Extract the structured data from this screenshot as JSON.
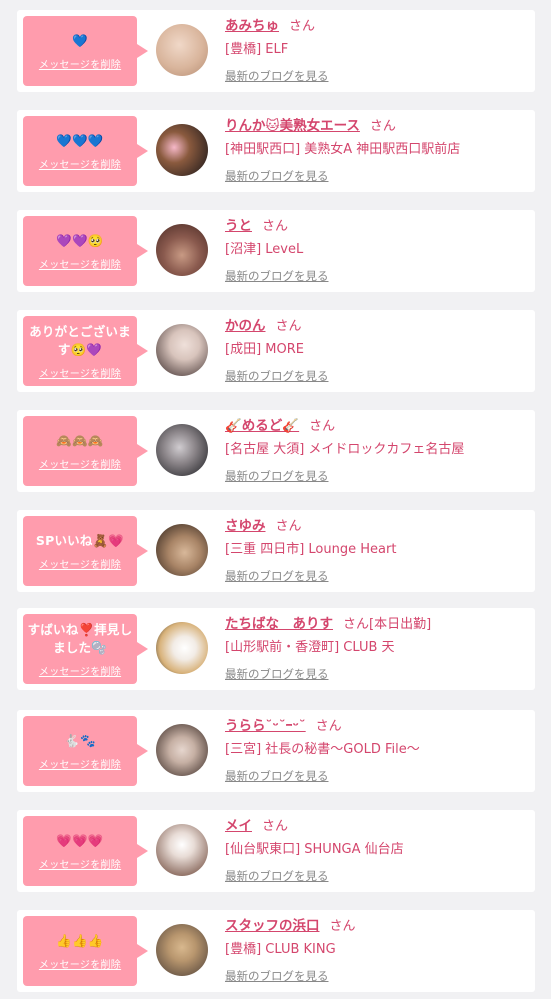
{
  "delete_label": "メッセージを削除",
  "san_label": "さん",
  "blog_label": "最新のブログを見る",
  "colors": {
    "bubble": "#ff9cad",
    "name": "#d4466d",
    "background": "#f1f1f3"
  },
  "items": [
    {
      "message": "💙",
      "name": "あみちゅ",
      "extra": "",
      "shop": "[豊橋] ELF",
      "avatar_colors": [
        "#d9b59c",
        "#f0d8c8"
      ]
    },
    {
      "message": "💙💙💙",
      "name": "りんか🐱美熟女エース",
      "extra": "",
      "shop": "[神田駅西口] 美熟女A 神田駅西口駅前店",
      "avatar_colors": [
        "#3a2a24",
        "#8a5a3e"
      ]
    },
    {
      "message": "💜💜🥺",
      "name": "うと",
      "extra": "",
      "shop": "[沼津] LeveL",
      "avatar_colors": [
        "#6a4036",
        "#c89a84"
      ]
    },
    {
      "message": "ありがとございます🥺💜",
      "name": "かのん",
      "extra": "",
      "shop": "[成田] MORE",
      "avatar_colors": [
        "#5a4a48",
        "#d8c4bc"
      ]
    },
    {
      "message": "🙈🙈🙈",
      "name": "🎸めるど🎸",
      "extra": "",
      "shop": "[名古屋 大須] メイドロックカフェ名古屋",
      "avatar_colors": [
        "#3a3a3e",
        "#d0ccd0"
      ]
    },
    {
      "message": "SPいいね🧸💗",
      "name": "さゆみ",
      "extra": "",
      "shop": "[三重 四日市] Lounge Heart",
      "avatar_colors": [
        "#4e3a2e",
        "#a88466"
      ]
    },
    {
      "message": "すばいね❣️拝見しました🫧",
      "name": "たちばな　ありす",
      "extra": "[本日出勤]",
      "shop": "[山形駅前・香澄町] CLUB 天",
      "avatar_colors": [
        "#d8b27a",
        "#f2ece6"
      ]
    },
    {
      "message": "🐇🐾",
      "name": "うらら˘ᵕ˘ｰᵕ˘",
      "extra": "",
      "shop": "[三宮] 社長の秘書〜GOLD File〜",
      "avatar_colors": [
        "#4a3a34",
        "#c6b0a4"
      ]
    },
    {
      "message": "💗💗💗",
      "name": "メイ",
      "extra": "",
      "shop": "[仙台駅東口] SHUNGA 仙台店",
      "avatar_colors": [
        "#8a6a5e",
        "#e8dcd6"
      ]
    },
    {
      "message": "👍👍👍",
      "name": "スタッフの浜口",
      "extra": "",
      "shop": "[豊橋] CLUB KING",
      "avatar_colors": [
        "#5a4a3e",
        "#b8966e"
      ]
    }
  ]
}
